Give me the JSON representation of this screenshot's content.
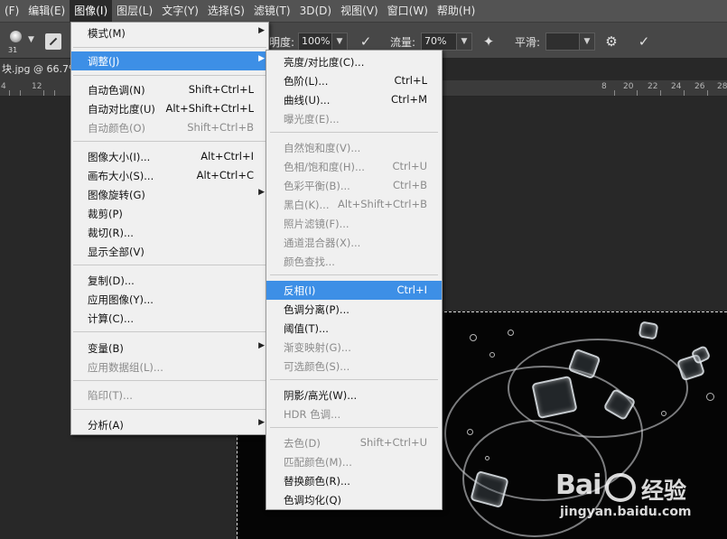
{
  "menubar": {
    "items": [
      "(F)",
      "编辑(E)",
      "图像(I)",
      "图层(L)",
      "文字(Y)",
      "选择(S)",
      "滤镜(T)",
      "3D(D)",
      "视图(V)",
      "窗口(W)",
      "帮助(H)"
    ]
  },
  "options": {
    "brush_size": "31",
    "opacity_label": "明度:",
    "opacity_value": "100%",
    "flow_label": "流量:",
    "flow_value": "70%",
    "smooth_label": "平滑:",
    "smooth_value": ""
  },
  "document": {
    "tab_title": "块.jpg @ 66.7%"
  },
  "ruler": {
    "labels": [
      "4",
      "12",
      "",
      "",
      "",
      "",
      "",
      "",
      "",
      "",
      "",
      "",
      "",
      "",
      "",
      "",
      "",
      "",
      "8",
      "20",
      "22",
      "24",
      "26",
      "28"
    ]
  },
  "image_menu": {
    "items": [
      {
        "label": "模式(M)",
        "shortcut": "",
        "submenu": true,
        "disabled": false
      },
      {
        "label": "调整(J)",
        "shortcut": "",
        "submenu": true,
        "disabled": false,
        "highlighted": true
      },
      {
        "label": "自动色调(N)",
        "shortcut": "Shift+Ctrl+L",
        "disabled": false
      },
      {
        "label": "自动对比度(U)",
        "shortcut": "Alt+Shift+Ctrl+L",
        "disabled": false
      },
      {
        "label": "自动颜色(O)",
        "shortcut": "Shift+Ctrl+B",
        "disabled": true
      },
      {
        "label": "图像大小(I)...",
        "shortcut": "Alt+Ctrl+I",
        "disabled": false
      },
      {
        "label": "画布大小(S)...",
        "shortcut": "Alt+Ctrl+C",
        "disabled": false
      },
      {
        "label": "图像旋转(G)",
        "shortcut": "",
        "submenu": true,
        "disabled": false
      },
      {
        "label": "裁剪(P)",
        "shortcut": "",
        "disabled": false
      },
      {
        "label": "裁切(R)...",
        "shortcut": "",
        "disabled": false
      },
      {
        "label": "显示全部(V)",
        "shortcut": "",
        "disabled": false
      },
      {
        "label": "复制(D)...",
        "shortcut": "",
        "disabled": false
      },
      {
        "label": "应用图像(Y)...",
        "shortcut": "",
        "disabled": false
      },
      {
        "label": "计算(C)...",
        "shortcut": "",
        "disabled": false
      },
      {
        "label": "变量(B)",
        "shortcut": "",
        "submenu": true,
        "disabled": false
      },
      {
        "label": "应用数据组(L)...",
        "shortcut": "",
        "disabled": true
      },
      {
        "label": "陷印(T)...",
        "shortcut": "",
        "disabled": true
      },
      {
        "label": "分析(A)",
        "shortcut": "",
        "submenu": true,
        "disabled": false
      }
    ]
  },
  "adjust_menu": {
    "items": [
      {
        "label": "亮度/对比度(C)...",
        "shortcut": "",
        "disabled": false
      },
      {
        "label": "色阶(L)...",
        "shortcut": "Ctrl+L",
        "disabled": false
      },
      {
        "label": "曲线(U)...",
        "shortcut": "Ctrl+M",
        "disabled": false
      },
      {
        "label": "曝光度(E)...",
        "shortcut": "",
        "disabled": true
      },
      {
        "label": "自然饱和度(V)...",
        "shortcut": "",
        "disabled": true
      },
      {
        "label": "色相/饱和度(H)...",
        "shortcut": "Ctrl+U",
        "disabled": true
      },
      {
        "label": "色彩平衡(B)...",
        "shortcut": "Ctrl+B",
        "disabled": true
      },
      {
        "label": "黑白(K)...",
        "shortcut": "Alt+Shift+Ctrl+B",
        "disabled": true
      },
      {
        "label": "照片滤镜(F)...",
        "shortcut": "",
        "disabled": true
      },
      {
        "label": "通道混合器(X)...",
        "shortcut": "",
        "disabled": true
      },
      {
        "label": "颜色查找...",
        "shortcut": "",
        "disabled": true
      },
      {
        "label": "反相(I)",
        "shortcut": "Ctrl+I",
        "disabled": false,
        "highlighted": true
      },
      {
        "label": "色调分离(P)...",
        "shortcut": "",
        "disabled": false
      },
      {
        "label": "阈值(T)...",
        "shortcut": "",
        "disabled": false
      },
      {
        "label": "渐变映射(G)...",
        "shortcut": "",
        "disabled": true
      },
      {
        "label": "可选颜色(S)...",
        "shortcut": "",
        "disabled": true
      },
      {
        "label": "阴影/高光(W)...",
        "shortcut": "",
        "disabled": false
      },
      {
        "label": "HDR 色调...",
        "shortcut": "",
        "disabled": true
      },
      {
        "label": "去色(D)",
        "shortcut": "Shift+Ctrl+U",
        "disabled": true
      },
      {
        "label": "匹配颜色(M)...",
        "shortcut": "",
        "disabled": true
      },
      {
        "label": "替换颜色(R)...",
        "shortcut": "",
        "disabled": false
      },
      {
        "label": "色调均化(Q)",
        "shortcut": "",
        "disabled": false
      }
    ]
  },
  "watermark": {
    "logo": "Bai",
    "logo_cn": "经验",
    "url": "jingyan.baidu.com"
  },
  "colors": {
    "menubar_bg": "#535353",
    "options_bg": "#474747",
    "menu_bg": "#f0f0f0",
    "highlight": "#3d8fe6",
    "workspace_bg": "#282828"
  }
}
